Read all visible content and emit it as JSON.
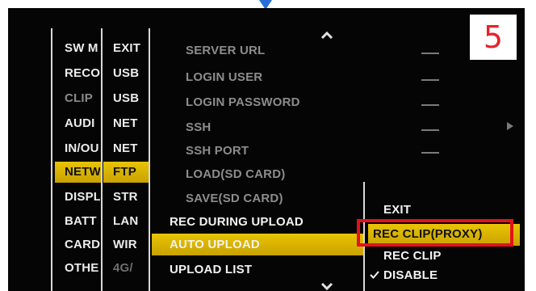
{
  "annotation_number": "5",
  "col1": [
    {
      "label": "SW M",
      "state": "normal"
    },
    {
      "label": "RECO",
      "state": "normal"
    },
    {
      "label": "CLIP",
      "state": "dim"
    },
    {
      "label": "AUDI",
      "state": "normal"
    },
    {
      "label": "IN/OU",
      "state": "normal"
    },
    {
      "label": "NETW",
      "state": "selected"
    },
    {
      "label": "DISPL",
      "state": "normal"
    },
    {
      "label": "BATT",
      "state": "normal"
    },
    {
      "label": "CARD",
      "state": "normal"
    },
    {
      "label": "OTHE",
      "state": "normal"
    }
  ],
  "col2": [
    {
      "label": "EXIT",
      "state": "normal"
    },
    {
      "label": "USB",
      "state": "normal"
    },
    {
      "label": "USB",
      "state": "normal"
    },
    {
      "label": "NET",
      "state": "normal"
    },
    {
      "label": "NET",
      "state": "normal"
    },
    {
      "label": "FTP",
      "state": "selected"
    },
    {
      "label": "STR",
      "state": "normal"
    },
    {
      "label": "LAN",
      "state": "normal"
    },
    {
      "label": "WIR",
      "state": "normal"
    },
    {
      "label": "4G/",
      "state": "dim"
    }
  ],
  "col3": [
    {
      "label": "SERVER URL",
      "value": "—",
      "state": "dim"
    },
    {
      "label": "LOGIN USER",
      "value": "—",
      "state": "dim"
    },
    {
      "label": "LOGIN PASSWORD",
      "value": "—",
      "state": "dim"
    },
    {
      "label": "SSH",
      "value": "—",
      "state": "dim"
    },
    {
      "label": "SSH PORT",
      "value": "—",
      "state": "dim"
    },
    {
      "label": "LOAD(SD CARD)",
      "value": "",
      "state": "dim"
    },
    {
      "label": "SAVE(SD CARD)",
      "value": "",
      "state": "dim"
    },
    {
      "label": "REC DURING UPLOAD",
      "value": "",
      "state": "active"
    },
    {
      "label": "AUTO UPLOAD",
      "value": "",
      "state": "selected"
    },
    {
      "label": "UPLOAD LIST",
      "value": "",
      "state": "active"
    }
  ],
  "col4": [
    {
      "label": "EXIT",
      "state": "normal",
      "checked": false
    },
    {
      "label": "REC CLIP(PROXY)",
      "state": "selected",
      "checked": false
    },
    {
      "label": "REC CLIP",
      "state": "normal",
      "checked": false
    },
    {
      "label": "DISABLE",
      "state": "normal",
      "checked": true
    }
  ],
  "colors": {
    "highlight": "#d4ad00",
    "annotation_red": "#e3111b",
    "marker_blue": "#2a6fd6"
  }
}
